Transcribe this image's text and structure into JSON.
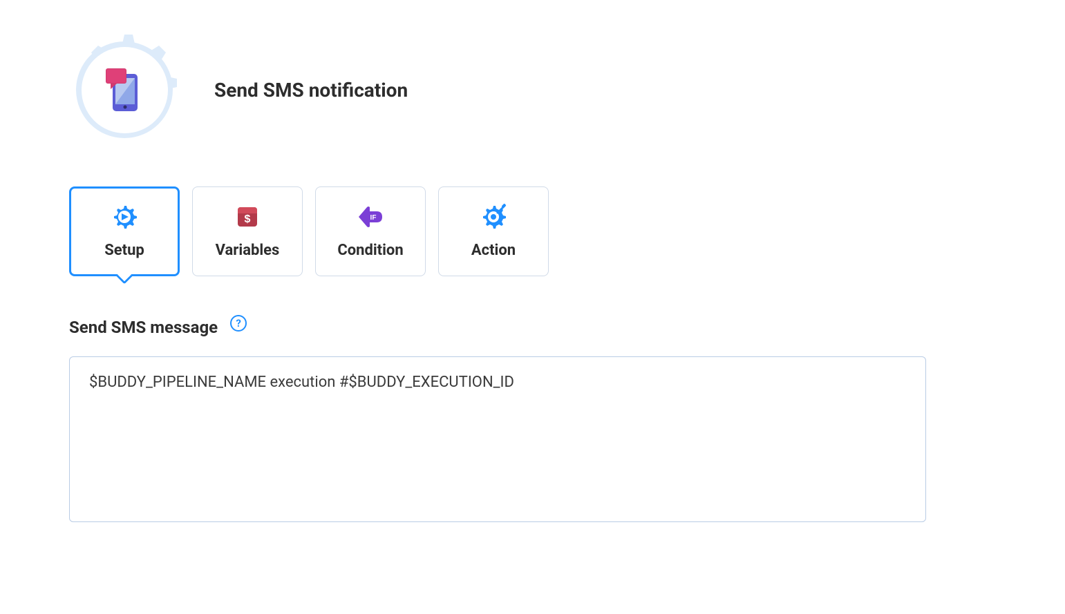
{
  "header": {
    "title": "Send SMS notification"
  },
  "tabs": [
    {
      "label": "Setup",
      "active": true
    },
    {
      "label": "Variables",
      "active": false
    },
    {
      "label": "Condition",
      "active": false
    },
    {
      "label": "Action",
      "active": false
    }
  ],
  "section": {
    "label": "Send SMS message",
    "help_glyph": "?"
  },
  "message": {
    "value": "$BUDDY_PIPELINE_NAME execution #$BUDDY_EXECUTION_ID"
  }
}
